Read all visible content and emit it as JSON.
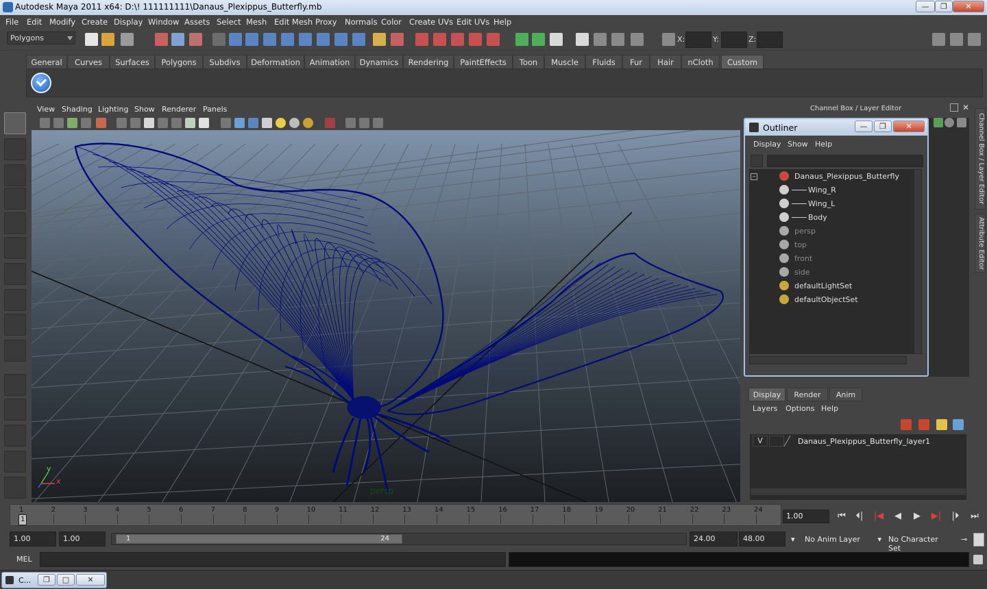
{
  "window": {
    "title": "Autodesk Maya 2011 x64: D:\\! 111111111\\Danaus_Plexippus_Butterfly.mb",
    "minimize": "—",
    "maximize": "❐",
    "close": "✕"
  },
  "menubar": [
    "File",
    "Edit",
    "Modify",
    "Create",
    "Display",
    "Window",
    "Assets",
    "Select",
    "Mesh",
    "Edit Mesh",
    "Proxy",
    "Normals",
    "Color",
    "Create UVs",
    "Edit UVs",
    "Help"
  ],
  "status": {
    "mode": "Polygons",
    "x_label": "X:",
    "y_label": "Y:",
    "z_label": "Z:"
  },
  "shelf_tabs": [
    "General",
    "Curves",
    "Surfaces",
    "Polygons",
    "Subdivs",
    "Deformation",
    "Animation",
    "Dynamics",
    "Rendering",
    "PaintEffects",
    "Toon",
    "Muscle",
    "Fluids",
    "Fur",
    "Hair",
    "nCloth",
    "Custom"
  ],
  "shelf_active_tab": "Custom",
  "viewport": {
    "menu": [
      "View",
      "Shading",
      "Lighting",
      "Show",
      "Renderer",
      "Panels"
    ],
    "camera_label": "persp",
    "axis_y": "y",
    "axis_x": "x",
    "wire_color": "#000a7a"
  },
  "channel_box": {
    "title": "Channel Box / Layer Editor"
  },
  "outliner": {
    "title": "Outliner",
    "menu": [
      "Display",
      "Show",
      "Help"
    ],
    "collapse": "–",
    "items": [
      {
        "label": "Danaus_Plexippus_Butterfly",
        "icon": "transform-group-icon",
        "level": 0,
        "dim": false
      },
      {
        "label": "Wing_R",
        "icon": "mesh-icon",
        "level": 1,
        "dim": false
      },
      {
        "label": "Wing_L",
        "icon": "mesh-icon",
        "level": 1,
        "dim": false
      },
      {
        "label": "Body",
        "icon": "mesh-icon",
        "level": 1,
        "dim": false
      },
      {
        "label": "persp",
        "icon": "camera-icon",
        "level": 0,
        "dim": true
      },
      {
        "label": "top",
        "icon": "camera-icon",
        "level": 0,
        "dim": true
      },
      {
        "label": "front",
        "icon": "camera-icon",
        "level": 0,
        "dim": true
      },
      {
        "label": "side",
        "icon": "camera-icon",
        "level": 0,
        "dim": true
      },
      {
        "label": "defaultLightSet",
        "icon": "set-icon",
        "level": 0,
        "dim": false
      },
      {
        "label": "defaultObjectSet",
        "icon": "set-icon",
        "level": 0,
        "dim": false
      }
    ]
  },
  "side_tabs": [
    "Channel Box / Layer Editor",
    "Attribute Editor"
  ],
  "layer_editor": {
    "tabs": [
      "Display",
      "Render",
      "Anim"
    ],
    "active_tab": "Display",
    "menu": [
      "Layers",
      "Options",
      "Help"
    ],
    "layers": [
      {
        "visible": "V",
        "name": "Danaus_Plexippus_Butterfly_layer1"
      }
    ]
  },
  "timeline": {
    "ticks": [
      "1",
      "2",
      "3",
      "4",
      "5",
      "6",
      "7",
      "8",
      "9",
      "10",
      "11",
      "12",
      "13",
      "14",
      "15",
      "16",
      "17",
      "18",
      "19",
      "20",
      "21",
      "22",
      "23",
      "24"
    ],
    "current_marker": "1",
    "current_frame": "1.00",
    "playback": [
      "⏮",
      "⏴|",
      "|◀",
      "◀",
      "▶",
      "▶|",
      "|⏵",
      "⏭"
    ]
  },
  "range": {
    "start": "1.00",
    "playback_start": "1.00",
    "slider_start": "1",
    "slider_end": "24",
    "playback_end": "24.00",
    "end": "48.00",
    "anim_layer": "No Anim Layer",
    "character_set": "No Character Set"
  },
  "command": {
    "label": "MEL",
    "input": "",
    "result": ""
  },
  "taskbar": {
    "item": "C...",
    "restore": "❐",
    "maximize": "□",
    "close": "✕"
  }
}
